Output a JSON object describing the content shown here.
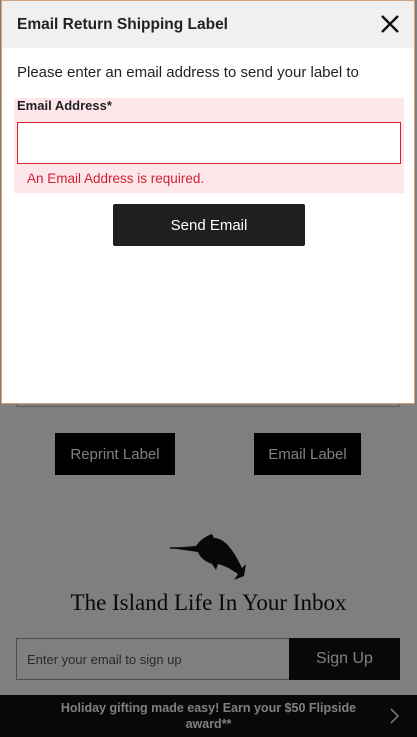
{
  "modal": {
    "title": "Email Return Shipping Label",
    "instructions": "Please enter an email address to send your label to",
    "field_label": "Email Address*",
    "field_value": "",
    "error": "An Email Address is required.",
    "send_label": "Send Email"
  },
  "background": {
    "reprint_label": "Reprint Label",
    "email_label": "Email Label",
    "newsletter_title": "The Island Life In Your Inbox",
    "newsletter_placeholder": "Enter your email to sign up",
    "signup_label": "Sign Up",
    "promo_text": "Holiday gifting made easy! Earn your $50 Flipside award**"
  },
  "icons": {
    "close": "close-icon",
    "logo": "marlin-logo-icon",
    "promo_chevron": "chevron-right-icon"
  },
  "colors": {
    "error": "#cf2231",
    "error_bg": "#fde7ea",
    "button": "#1f1f1f",
    "header_bg": "#f0f0f0"
  }
}
